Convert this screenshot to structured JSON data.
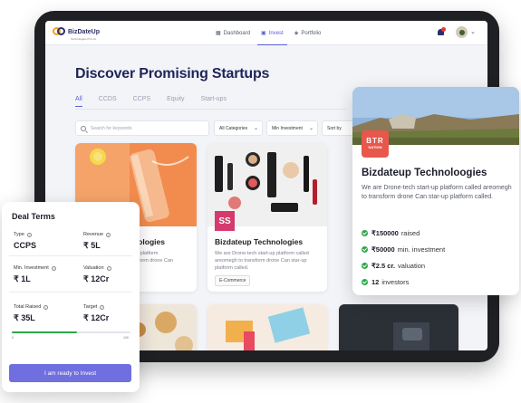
{
  "brand": {
    "name": "BizDateUp",
    "tagline": "Technologies Pvt Ltd"
  },
  "nav": {
    "items": [
      {
        "icon": "dashboard-icon",
        "label": "Dashboard",
        "active": false
      },
      {
        "icon": "invest-icon",
        "label": "Invest",
        "active": true
      },
      {
        "icon": "portfolio-icon",
        "label": "Portfolio",
        "active": false
      }
    ],
    "notification_icon": "bell-icon",
    "avatar_icon": "user-avatar"
  },
  "page": {
    "title": "Discover Promising Startups",
    "tabs": [
      "All",
      "CCDS",
      "CCPS",
      "Equity",
      "Start-ups"
    ],
    "search_placeholder": "Search for keywords",
    "filters": {
      "category": "All Categories",
      "min_investment": "Min Investment",
      "sort": "Sort by"
    }
  },
  "cards": [
    {
      "title": "Bizdateup Technoloogies",
      "title_visible": "nologies",
      "desc": "We are Drone-tech start-up platform called areomegh to transform drone Can star-up platform called.",
      "desc_visible": "up platform\nnsform drone Can"
    },
    {
      "title": "Bizdateup Technologies",
      "desc": "We are Drone-tech start-up platform called areomegh to transform drone Can star-up platform called.",
      "tag": "E-Commerce",
      "logo": "SS"
    }
  ],
  "featured": {
    "logo_lines": [
      "BTR",
      "NATION"
    ],
    "title": "Bizdateup Technoloogies",
    "desc": "We are Drone-tech start-up platform called areomegh to transform drone Can star-up platform called.",
    "stats": [
      {
        "value": "₹150000",
        "label": "raised"
      },
      {
        "value": "₹50000",
        "label": "min. investment"
      },
      {
        "value": "₹2.5 cr.",
        "label": "valuation"
      },
      {
        "value": "12",
        "label": "investors"
      }
    ]
  },
  "deal_terms": {
    "title": "Deal Terms",
    "type_label": "Type",
    "type_value": "CCPS",
    "revenue_label": "Revenue",
    "revenue_value": "₹ 5L",
    "min_inv_label": "Min. Investment",
    "min_inv_value": "₹ 1L",
    "valuation_label": "Valuation",
    "valuation_value": "₹ 12Cr",
    "total_raised_label": "Total Raised",
    "total_raised_value": "₹ 35L",
    "target_label": "Target",
    "target_value": "₹ 12Cr",
    "progress_start": "0",
    "progress_end": "100",
    "progress_fraction": 0.55,
    "cta": "I am ready to Invest"
  },
  "colors": {
    "accent": "#5b5fd6",
    "brand_navy": "#1f2459",
    "success": "#2ba84a",
    "cta": "#6f6fe0"
  }
}
